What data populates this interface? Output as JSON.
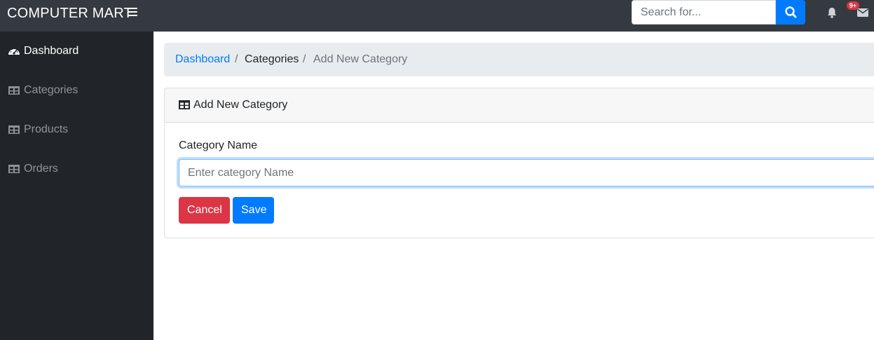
{
  "topbar": {
    "brand": "COMPUTER MART",
    "search_placeholder": "Search for...",
    "notifications_badge": "9+"
  },
  "sidebar": {
    "items": [
      {
        "label": "Dashboard",
        "icon": "dashboard-icon",
        "active": true
      },
      {
        "label": "Categories",
        "icon": "table-icon",
        "active": false
      },
      {
        "label": "Products",
        "icon": "table-icon",
        "active": false
      },
      {
        "label": "Orders",
        "icon": "table-icon",
        "active": false
      }
    ]
  },
  "breadcrumb": {
    "items": [
      "Dashboard",
      "Categories",
      "Add New Category"
    ],
    "separator": "/"
  },
  "card": {
    "title": "Add New Category",
    "field_label": "Category Name",
    "field_placeholder": "Enter category Name",
    "field_value": "",
    "cancel_label": "Cancel",
    "save_label": "Save"
  },
  "colors": {
    "topbar": "#343a40",
    "sidebar": "#212529",
    "primary": "#007bff",
    "danger": "#dc3545",
    "breadcrumb_bg": "#e9ecef"
  }
}
